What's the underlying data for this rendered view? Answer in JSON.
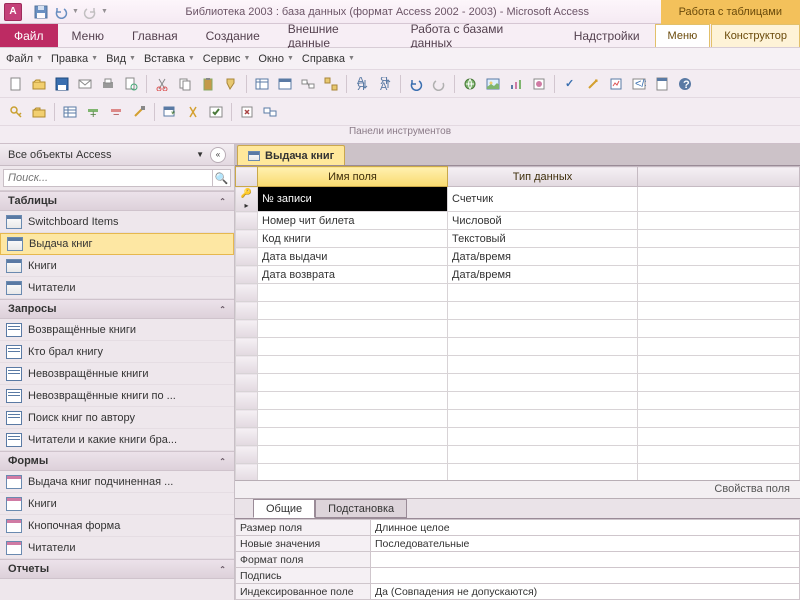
{
  "title": "Библиотека 2003 : база данных (формат Access 2002 - 2003)  -  Microsoft Access",
  "context_tab": "Работа с таблицами",
  "file_tab": "Файл",
  "menu": [
    "Меню",
    "Главная",
    "Создание",
    "Внешние данные",
    "Работа с базами данных",
    "Надстройки"
  ],
  "ctx_tabs": [
    "Меню",
    "Конструктор"
  ],
  "toolbar_menus": [
    "Файл",
    "Правка",
    "Вид",
    "Вставка",
    "Сервис",
    "Окно",
    "Справка"
  ],
  "toolbar_caption": "Панели инструментов",
  "nav": {
    "title": "Все объекты Access",
    "search_ph": "Поиск...",
    "cats": {
      "tables": "Таблицы",
      "queries": "Запросы",
      "forms": "Формы",
      "reports": "Отчеты"
    },
    "tables": [
      "Switchboard Items",
      "Выдача книг",
      "Книги",
      "Читатели"
    ],
    "queries": [
      "Возвращённые книги",
      "Кто брал книгу",
      "Невозвращённые книги",
      "Невозвращённые книги по ...",
      "Поиск книг по автору",
      "Читатели и какие книги бра..."
    ],
    "forms": [
      "Выдача книг подчиненная ...",
      "Книги",
      "Кнопочная форма",
      "Читатели"
    ]
  },
  "doc_tab": "Выдача книг",
  "field_headers": [
    "Имя поля",
    "Тип данных"
  ],
  "fields": [
    {
      "name": "№ записи",
      "type": "Счетчик",
      "key": true,
      "sel": true
    },
    {
      "name": "Номер чит билета",
      "type": "Числовой"
    },
    {
      "name": "Код книги",
      "type": "Текстовый"
    },
    {
      "name": "Дата выдачи",
      "type": "Дата/время"
    },
    {
      "name": "Дата возврата",
      "type": "Дата/время"
    }
  ],
  "prop_title": "Свойства поля",
  "prop_tabs": [
    "Общие",
    "Подстановка"
  ],
  "props": [
    {
      "k": "Размер поля",
      "v": "Длинное целое"
    },
    {
      "k": "Новые значения",
      "v": "Последовательные"
    },
    {
      "k": "Формат поля",
      "v": ""
    },
    {
      "k": "Подпись",
      "v": ""
    },
    {
      "k": "Индексированное поле",
      "v": "Да (Совпадения не допускаются)"
    }
  ]
}
